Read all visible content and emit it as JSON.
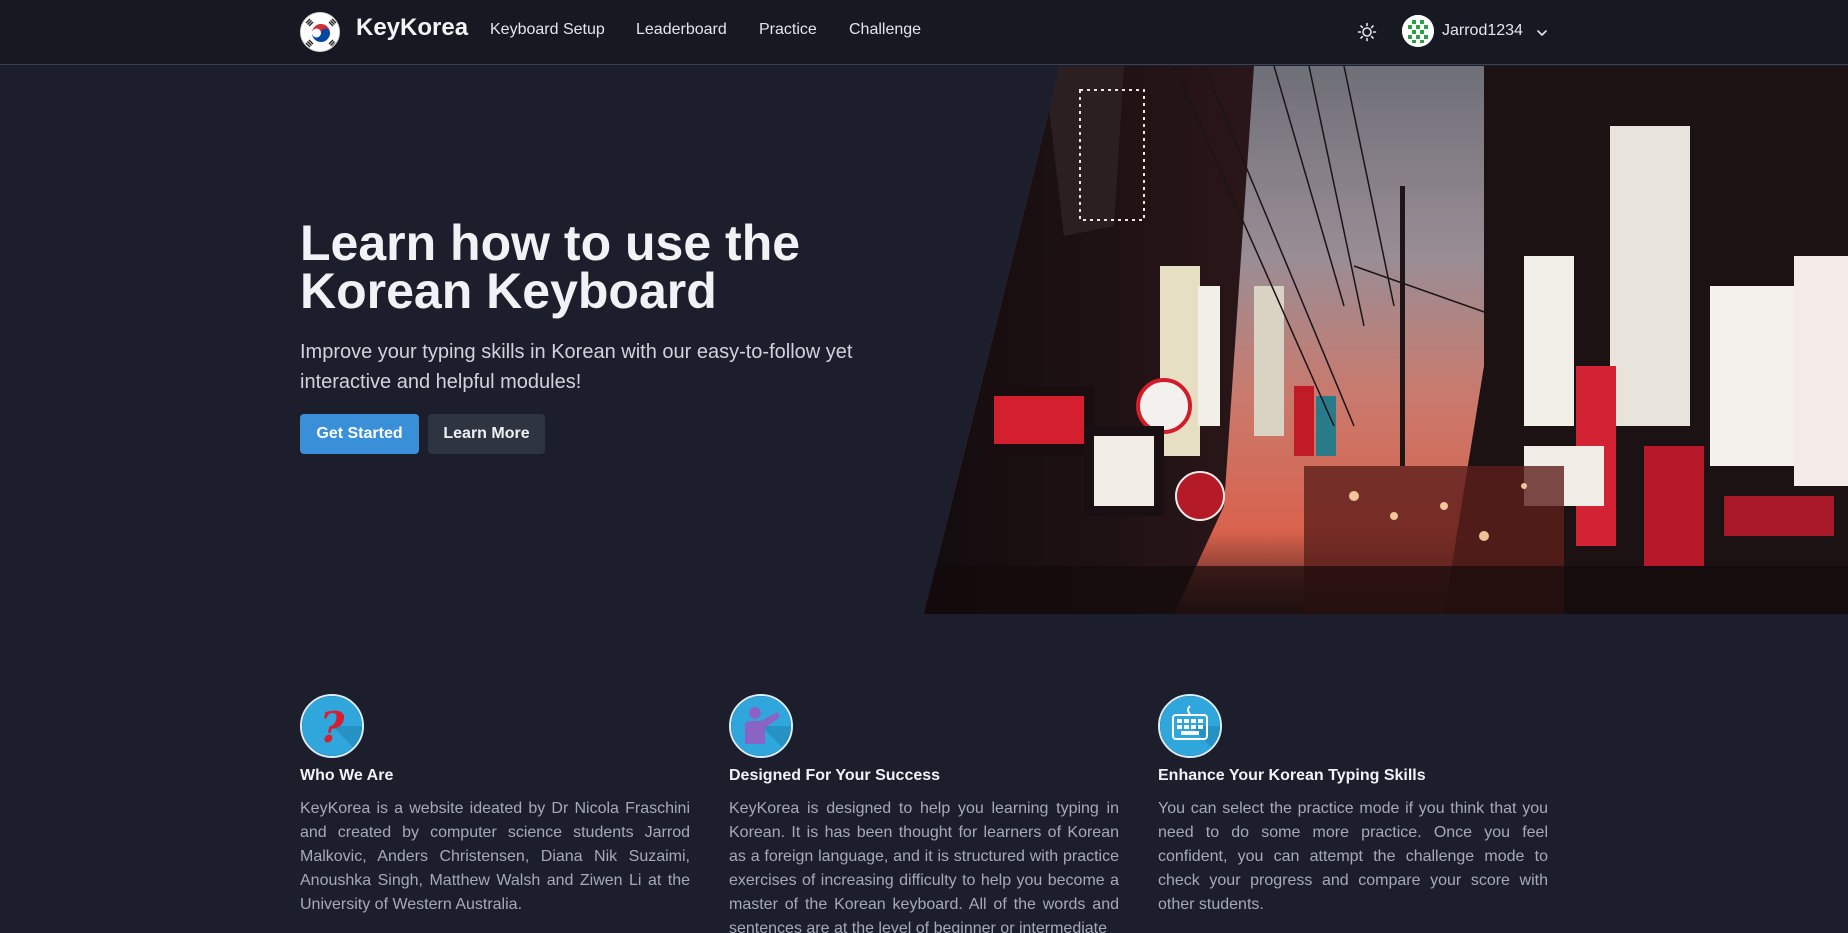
{
  "nav": {
    "brand": "KeyKorea",
    "links": [
      "Keyboard Setup",
      "Leaderboard",
      "Practice",
      "Challenge"
    ],
    "username": "Jarrod1234",
    "theme_icon": "sun-icon",
    "chevron_icon": "chevron-down-icon"
  },
  "hero": {
    "title_line1": "Learn how to use the",
    "title_line2": "Korean Keyboard",
    "subtitle": "Improve your typing skills in Korean with our easy-to-follow yet interactive and helpful modules!",
    "primary_button": "Get Started",
    "secondary_button": "Learn More",
    "image_description_icon": "korean-street-photo"
  },
  "features": [
    {
      "icon": "question-mark-icon",
      "title": "Who We Are",
      "text": "KeyKorea is a website ideated by Dr Nicola Fraschini and created by computer science students Jarrod Malkovic, Anders Christensen, Diana Nik Suzaimi, Anoushka Singh, Matthew Walsh and Ziwen Li at the University of Western Australia."
    },
    {
      "icon": "teacher-icon",
      "title": "Designed For Your Success",
      "text": "KeyKorea is designed to help you learning typing in Korean. It is has been thought for learners of Korean as a foreign language, and it is structured with practice exercises of increasing difficulty to help you become a master of the Korean keyboard. All of the words and sentences are at the level of beginner or intermediate"
    },
    {
      "icon": "keyboard-icon",
      "title": "Enhance Your Korean Typing Skills",
      "text": "You can select the practice mode if you think that you need to do some more practice. Once you feel confident, you can attempt the challenge mode to check your progress and compare your score with other students."
    }
  ],
  "colors": {
    "background": "#1c1f2b",
    "navbar": "#161922",
    "primary": "#3a8fd9",
    "secondary": "#2f3441",
    "icon_blue": "#2fa7dd"
  }
}
